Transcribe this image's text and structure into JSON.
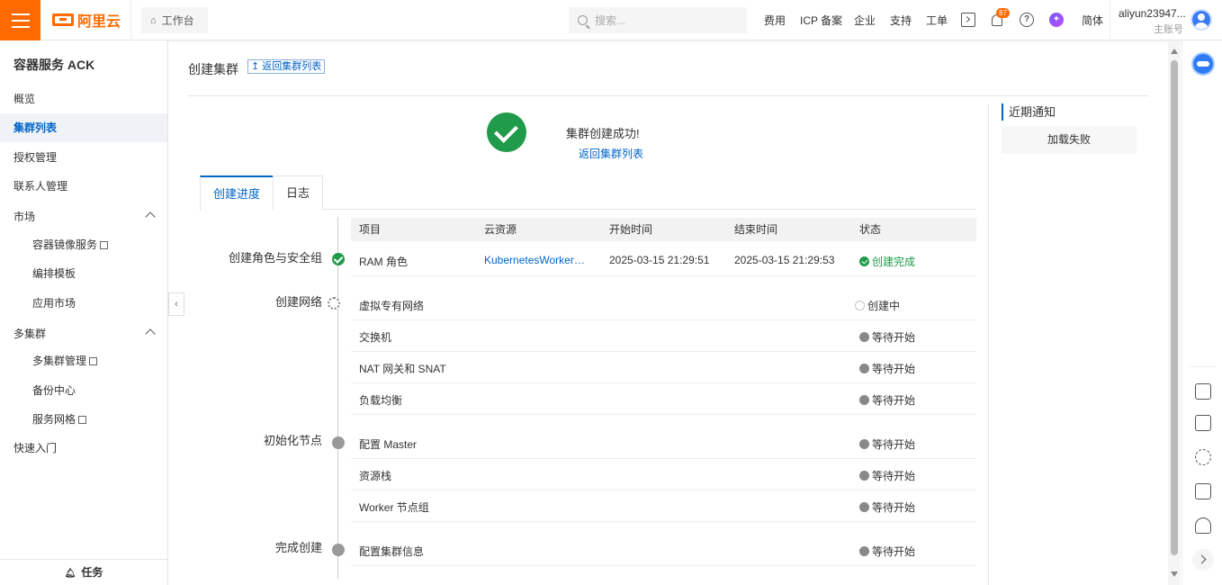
{
  "topbar": {
    "logo_text": "阿里云",
    "workbench": "工作台",
    "search_placeholder": "搜索...",
    "nav": [
      "费用",
      "ICP 备案",
      "企业",
      "支持",
      "工单"
    ],
    "notification_count": "87",
    "lang": "简体",
    "username": "aliyun23947...",
    "account_type": "主账号",
    "accent_color": "#ff6a00"
  },
  "sidebar": {
    "title": "容器服务 ACK",
    "items": [
      {
        "label": "概览"
      },
      {
        "label": "集群列表"
      },
      {
        "label": "授权管理"
      },
      {
        "label": "联系人管理"
      },
      {
        "label": "市场"
      },
      {
        "label": "容器镜像服务"
      },
      {
        "label": "编排模板"
      },
      {
        "label": "应用市场"
      },
      {
        "label": "多集群"
      },
      {
        "label": "多集群管理"
      },
      {
        "label": "备份中心"
      },
      {
        "label": "服务网格"
      },
      {
        "label": "快速入门"
      }
    ],
    "bottom": "任务"
  },
  "main": {
    "title": "创建集群",
    "back_link": "返回集群列表",
    "success_text": "集群创建成功!",
    "success_link": "返回集群列表",
    "tabs": [
      "创建进度",
      "日志"
    ],
    "columns": [
      "项目",
      "云资源",
      "开始时间",
      "结束时间",
      "状态"
    ],
    "stages": [
      "创建角色与安全组",
      "创建网络",
      "初始化节点",
      "完成创建"
    ],
    "rows": [
      {
        "item": "RAM 角色",
        "resource": "KubernetesWorkerRole...",
        "start": "2025-03-15 21:29:51",
        "end": "2025-03-15 21:29:53",
        "status": "创建完成"
      },
      {
        "item": "虚拟专有网络",
        "resource": "",
        "start": "",
        "end": "",
        "status": "创建中"
      },
      {
        "item": "交换机",
        "resource": "",
        "start": "",
        "end": "",
        "status": "等待开始"
      },
      {
        "item": "NAT 网关和 SNAT",
        "resource": "",
        "start": "",
        "end": "",
        "status": "等待开始"
      },
      {
        "item": "负载均衡",
        "resource": "",
        "start": "",
        "end": "",
        "status": "等待开始"
      },
      {
        "item": "配置 Master",
        "resource": "",
        "start": "",
        "end": "",
        "status": "等待开始"
      },
      {
        "item": "资源栈",
        "resource": "",
        "start": "",
        "end": "",
        "status": "等待开始"
      },
      {
        "item": "Worker 节点组",
        "resource": "",
        "start": "",
        "end": "",
        "status": "等待开始"
      },
      {
        "item": "配置集群信息",
        "resource": "",
        "start": "",
        "end": "",
        "status": "等待开始"
      }
    ]
  },
  "notice": {
    "title": "近期通知",
    "message": "加载失败"
  },
  "colors": {
    "primary": "#0064c8",
    "success": "#1f9b4b",
    "brand": "#ff6a00"
  }
}
